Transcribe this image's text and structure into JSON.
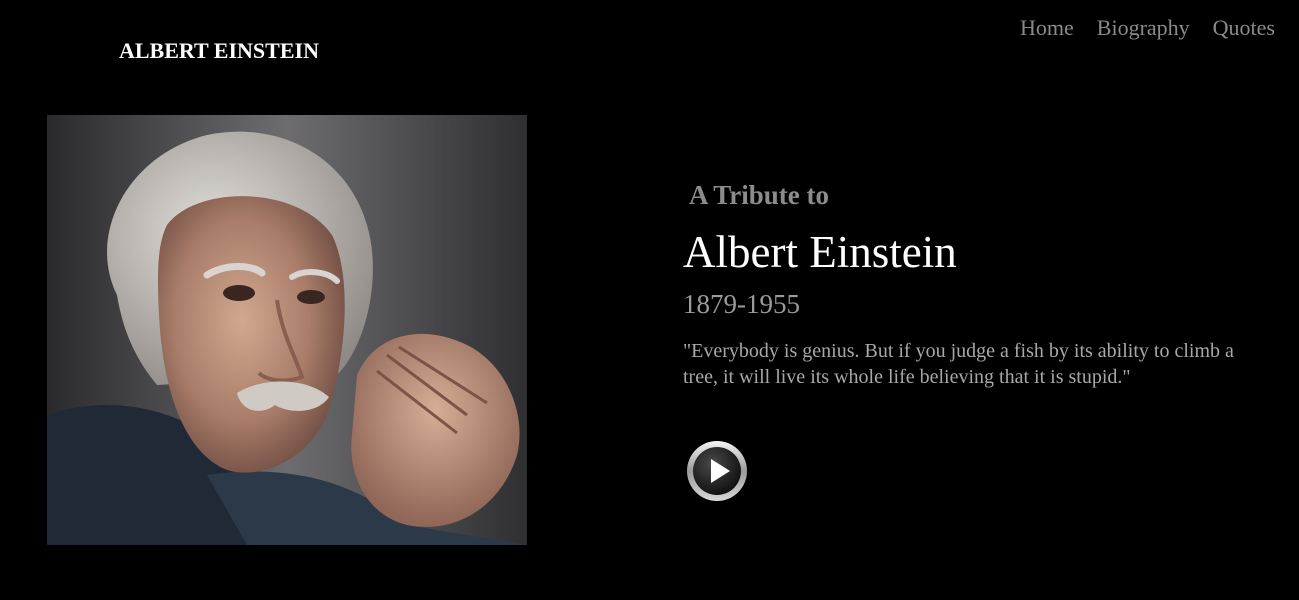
{
  "header": {
    "brand": "ALBERT EINSTEIN",
    "nav": [
      {
        "label": "Home"
      },
      {
        "label": "Biography"
      },
      {
        "label": "Quotes"
      }
    ]
  },
  "hero": {
    "portrait_icon": "einstein-portrait",
    "tribute": "A Tribute to",
    "name": "Albert Einstein",
    "years": "1879-1955",
    "quote": "\"Everybody is genius. But if you judge a fish by its ability to climb a tree, it will live its whole life believing that it is stupid.\"",
    "play_icon": "play-icon"
  },
  "colors": {
    "background": "#000000",
    "brand_text": "#ffffff",
    "nav_text": "#8a8a8a",
    "muted_text": "#9a9a9a"
  }
}
